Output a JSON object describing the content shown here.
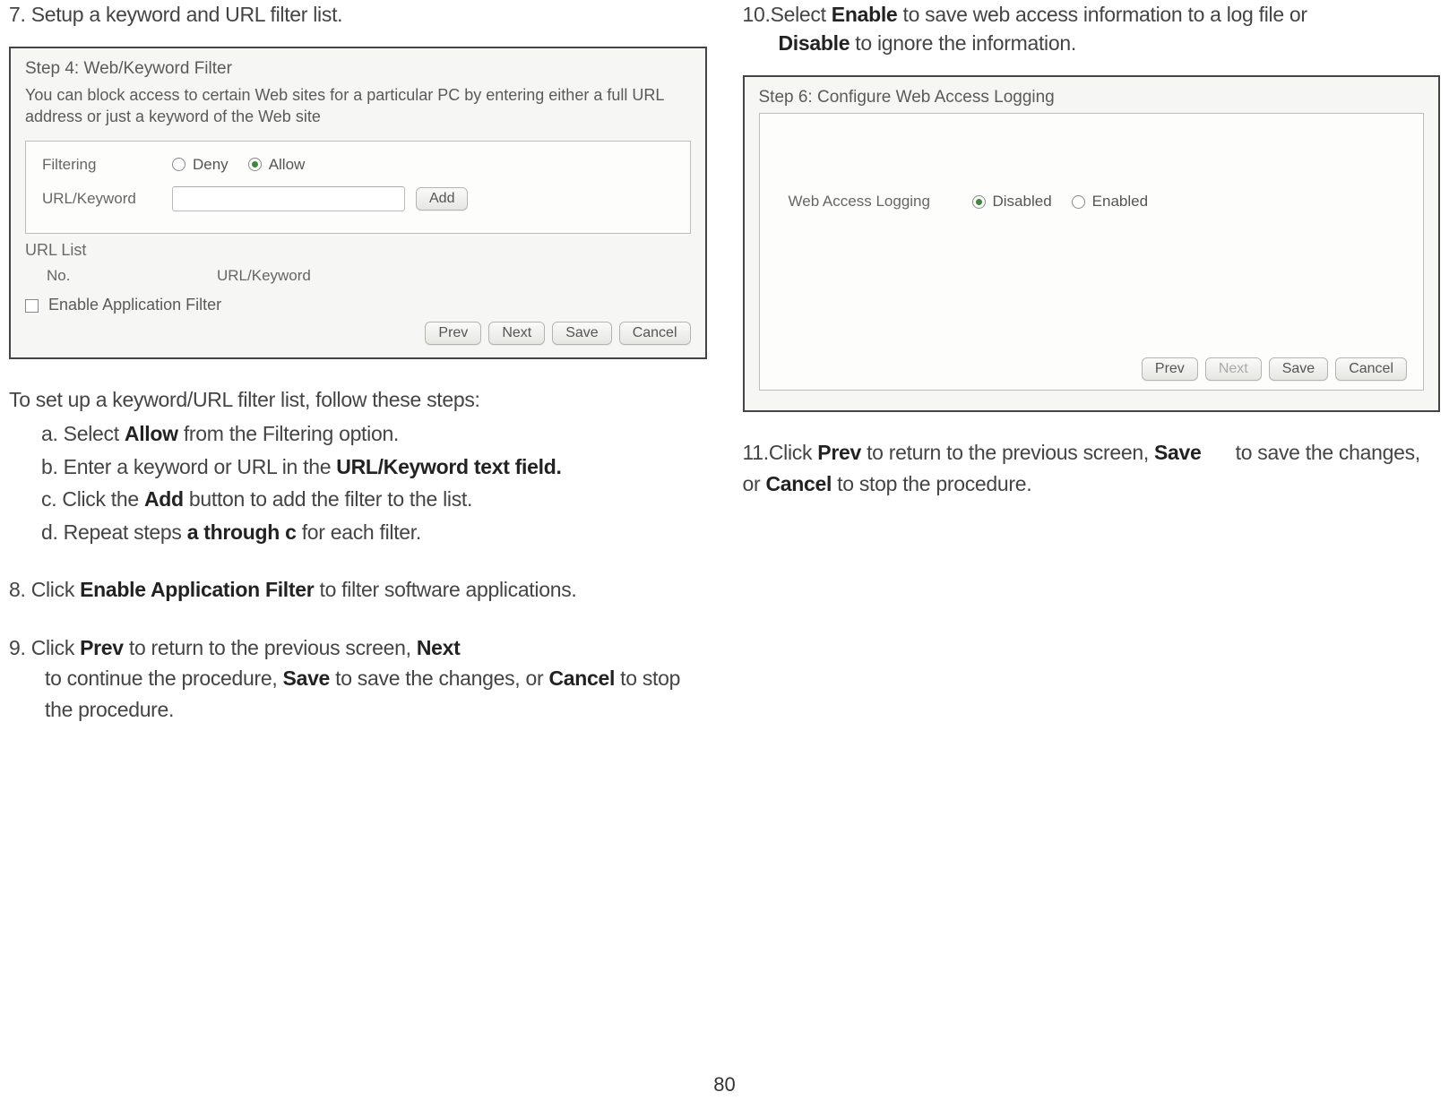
{
  "left": {
    "step7": {
      "num": "7.",
      "text": "Setup a keyword and URL filter list."
    },
    "panel4": {
      "title": "Step 4: Web/Keyword Filter",
      "desc": "You can block access to certain Web sites for a particular PC by entering either a full URL address or just a keyword of the Web site",
      "filtering_label": "Filtering",
      "deny": "Deny",
      "allow": "Allow",
      "urlkw_label": "URL/Keyword",
      "add": "Add",
      "url_list": "URL List",
      "col_no": "No.",
      "col_urlkw": "URL/Keyword",
      "enable_app_filter": "Enable Application Filter",
      "prev": "Prev",
      "next": "Next",
      "save": "Save",
      "cancel": "Cancel"
    },
    "intro": "To set up a keyword/URL filter list, follow these steps:",
    "sub": {
      "a_pre": "a. Select ",
      "a_bold": "Allow",
      "a_post": " from the Filtering option.",
      "b_pre": "b. Enter a keyword or URL in the ",
      "b_bold": "URL/Keyword text field.",
      "c_pre": "c. Click the ",
      "c_bold": "Add",
      "c_post": " button to add the filter to the list.",
      "d_pre": "d. Repeat steps ",
      "d_bold": "a through c",
      "d_post": " for each filter."
    },
    "step8": {
      "num": "8.",
      "pre": "Click ",
      "bold": "Enable Application Filter",
      "post": " to filter software applications."
    },
    "step9": {
      "num": "9.",
      "pre": "Click ",
      "b1": "Prev",
      "mid1": " to return to the previous screen, ",
      "b2": "Next",
      "mid2": " to continue the procedure, ",
      "b3": "Save",
      "mid3": " to save the changes, or ",
      "b4": "Cancel",
      "post": " to stop the procedure."
    }
  },
  "right": {
    "step10": {
      "num": "10.",
      "pre": "Select ",
      "b1": "Enable",
      "mid": " to save web access information to a log file or ",
      "b2": "Disable",
      "post": " to ignore the information."
    },
    "panel6": {
      "title": "Step 6: Configure Web Access Logging",
      "label": "Web Access Logging",
      "disabled": "Disabled",
      "enabled": "Enabled",
      "prev": "Prev",
      "next": "Next",
      "save": "Save",
      "cancel": "Cancel"
    },
    "step11": {
      "num": "11.",
      "pre": "Click ",
      "b1": "Prev",
      "mid1": " to return to the previous screen, ",
      "b2": "Save",
      "mid2": " to save the changes, or ",
      "b3": "Cancel",
      "post": " to stop the procedure."
    }
  },
  "page_number": "80"
}
